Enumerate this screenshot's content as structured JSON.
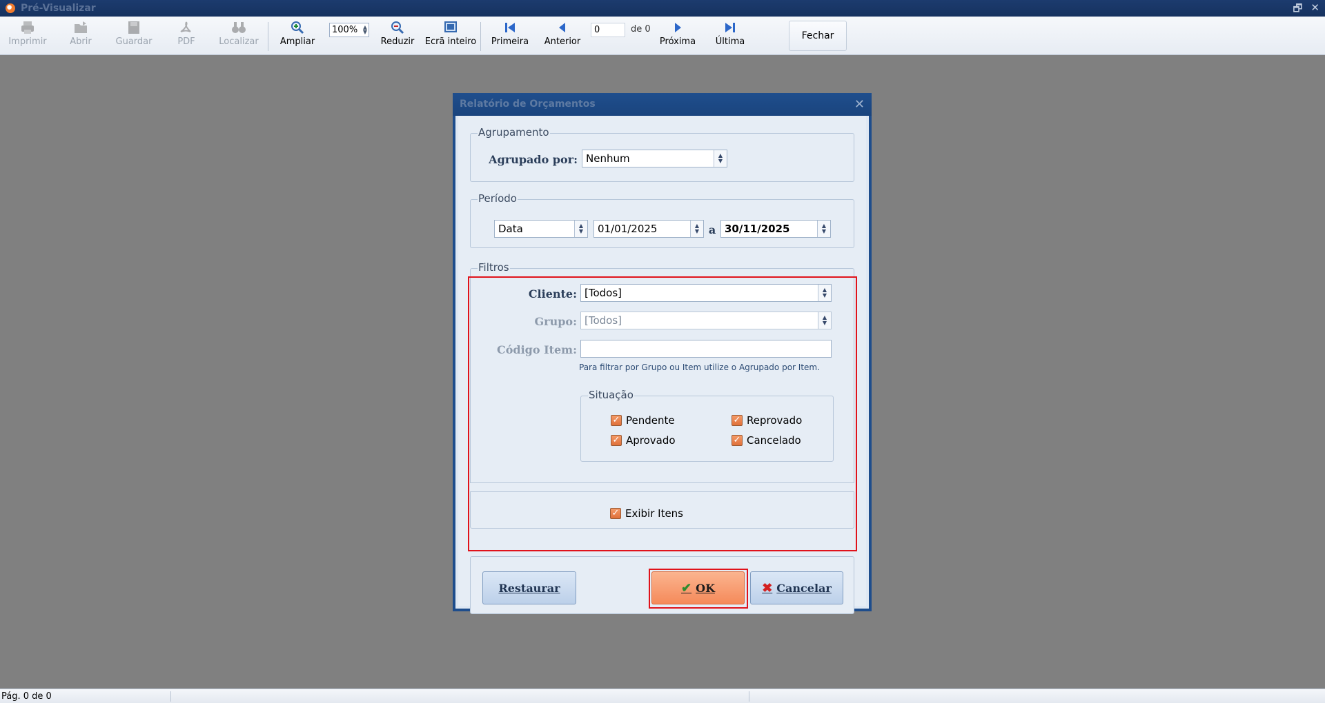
{
  "window": {
    "title": "Pré-Visualizar"
  },
  "toolbar": {
    "print": "Imprimir",
    "open": "Abrir",
    "save": "Guardar",
    "pdf": "PDF",
    "find": "Localizar",
    "zoom_in": "Ampliar",
    "zoom_value": "100%",
    "zoom_out": "Reduzir",
    "fullscreen": "Ecrã inteiro",
    "first": "Primeira",
    "previous": "Anterior",
    "page_value": "0",
    "page_of": "de 0",
    "next": "Próxima",
    "last": "Última",
    "close": "Fechar"
  },
  "dialog": {
    "title": "Relatório de Orçamentos",
    "grouping": {
      "legend": "Agrupamento",
      "label": "Agrupado por:",
      "value": "Nenhum"
    },
    "period": {
      "legend": "Período",
      "type_value": "Data",
      "from": "01/01/2025",
      "connector": "a",
      "to": "30/11/2025"
    },
    "filters": {
      "legend": "Filtros",
      "client_label": "Cliente:",
      "client_value": "[Todos]",
      "group_label": "Grupo:",
      "group_value": "[Todos]",
      "item_code_label": "Código Item:",
      "item_code_value": "",
      "hint": "Para filtrar por Grupo ou Item utilize o Agrupado por Item."
    },
    "status": {
      "legend": "Situação",
      "pending": "Pendente",
      "rejected": "Reprovado",
      "approved": "Aprovado",
      "cancelled": "Cancelado"
    },
    "show_items": "Exibir Itens",
    "buttons": {
      "restore": "Restaurar",
      "ok": "OK",
      "cancel": "Cancelar"
    }
  },
  "statusbar": {
    "text": "Pág. 0 de 0"
  },
  "colors": {
    "accent": "#f58a5a",
    "highlight": "#e0121a",
    "titlebar": "#1c3b6e"
  }
}
